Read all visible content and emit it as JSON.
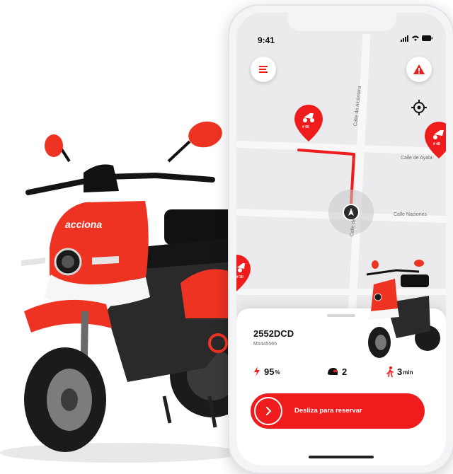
{
  "status_bar": {
    "time": "9:41"
  },
  "map": {
    "streets": [
      "Calle de Alcántara",
      "Calle de Ayala",
      "Calle Naciones",
      "Calle de"
    ],
    "pins": [
      {
        "battery": "# 95"
      },
      {
        "battery": "# 48"
      },
      {
        "battery": "# 30"
      }
    ]
  },
  "vehicle": {
    "brand": "acciona",
    "plate": "2552DCD",
    "id": "M#445565",
    "battery_value": "95",
    "battery_unit": "%",
    "helmets": "2",
    "walk_time_value": "3",
    "walk_time_unit": "min"
  },
  "actions": {
    "swipe_label": "Desliza para reservar"
  },
  "colors": {
    "accent": "#ee1c1c",
    "map_bg": "#ebebed",
    "sheet_bg": "#ffffff"
  },
  "icons": [
    "menu-icon",
    "alert-icon",
    "locate-icon",
    "scooter-pin-icon",
    "navigation-arrow-icon",
    "lightning-icon",
    "helmet-icon",
    "walk-icon",
    "chevron-right-icon",
    "signal-icon",
    "wifi-icon",
    "battery-icon"
  ]
}
